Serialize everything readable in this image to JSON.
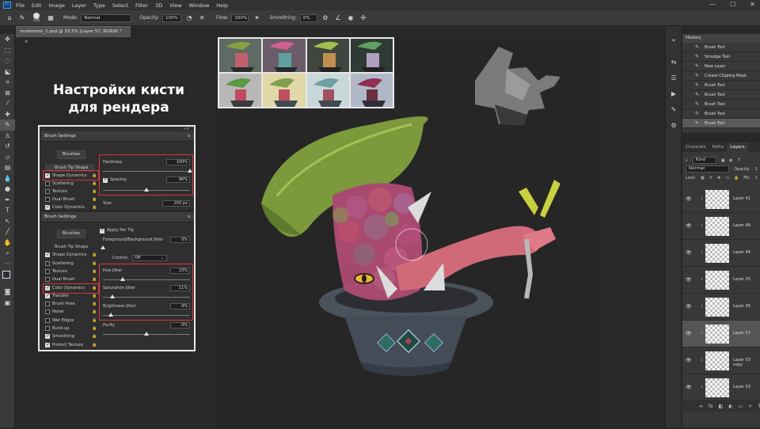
{
  "app": {
    "logo": "Ps"
  },
  "menu": [
    "File",
    "Edit",
    "Image",
    "Layer",
    "Type",
    "Select",
    "Filter",
    "3D",
    "View",
    "Window",
    "Help"
  ],
  "window_controls": [
    "—",
    "☐",
    "✕"
  ],
  "options_bar": {
    "brush_size": "200",
    "mode_label": "Mode:",
    "mode_value": "Normal",
    "opacity_label": "Opacity:",
    "opacity_value": "100%",
    "flow_label": "Flow:",
    "flow_value": "100%",
    "smoothing_label": "Smoothing:",
    "smoothing_value": "0%"
  },
  "document_tab": {
    "title": "mushroom_1.psd @ 33,3% (Layer 57, RGB/8) *",
    "close": "×"
  },
  "title_overlay": {
    "line1": "Настройки кисти",
    "line2": "для рендера"
  },
  "brush_panel": {
    "header": "Brush Settings",
    "top_section": {
      "brushes_button": "Brushes",
      "items": [
        {
          "label": "Brush Tip Shape",
          "checked": null
        },
        {
          "label": "Shape Dynamics",
          "checked": true
        },
        {
          "label": "Scattering",
          "checked": false
        },
        {
          "label": "Texture",
          "checked": false
        },
        {
          "label": "Dual Brush",
          "checked": false
        },
        {
          "label": "Color Dynamics",
          "checked": true
        }
      ],
      "hardness_label": "Hardness",
      "hardness_value": "100%",
      "hardness_level": 1.0,
      "spacing_label": "Spacing",
      "spacing_value": "96%",
      "spacing_level": 0.5,
      "size_label": "Size",
      "size_value": "200 px"
    },
    "bottom_section": {
      "header": "Brush Settings",
      "brushes_button": "Brushes",
      "apply_per_tip": "Apply Per Tip",
      "fg_bg_jitter_label": "Foreground/Background Jitter",
      "fg_bg_jitter_value": "0%",
      "control_label": "Control:",
      "control_value": "Off",
      "items": [
        {
          "label": "Brush Tip Shape",
          "checked": null
        },
        {
          "label": "Shape Dynamics",
          "checked": true
        },
        {
          "label": "Scattering",
          "checked": false
        },
        {
          "label": "Texture",
          "checked": false
        },
        {
          "label": "Dual Brush",
          "checked": false
        },
        {
          "label": "Color Dynamics",
          "checked": true
        },
        {
          "label": "Transfer",
          "checked": true
        },
        {
          "label": "Brush Pose",
          "checked": false
        },
        {
          "label": "Noise",
          "checked": false
        },
        {
          "label": "Wet Edges",
          "checked": false
        },
        {
          "label": "Build-up",
          "checked": false
        },
        {
          "label": "Smoothing",
          "checked": true
        },
        {
          "label": "Protect Texture",
          "checked": true
        }
      ],
      "hue_jitter_label": "Hue Jitter",
      "hue_jitter_value": "23%",
      "hue_jitter_level": 0.23,
      "saturation_jitter_label": "Saturation Jitter",
      "saturation_jitter_value": "11%",
      "saturation_jitter_level": 0.11,
      "brightness_jitter_label": "Brightness Jitter",
      "brightness_jitter_value": "9%",
      "brightness_jitter_level": 0.09,
      "purity_label": "Purity",
      "purity_value": "0%",
      "purity_level": 0.5
    }
  },
  "history": {
    "title": "History",
    "rows": [
      "Brush Tool",
      "Smudge Tool",
      "New Layer",
      "Create Clipping Mask",
      "Brush Tool",
      "Brush Tool",
      "Brush Tool",
      "Brush Tool",
      "Brush Tool"
    ]
  },
  "layers_panel": {
    "tabs": [
      "Channels",
      "Paths",
      "Layers"
    ],
    "kind_label": "Kind",
    "blend_mode": "Normal",
    "opacity_label": "Opacity:",
    "opacity_value": "1",
    "lock_label": "Lock:",
    "fill_label": "Fill:",
    "fill_value": "1",
    "layers": [
      {
        "name": "Layer 41",
        "selected": false
      },
      {
        "name": "Layer 46",
        "selected": false
      },
      {
        "name": "Layer 44",
        "selected": false
      },
      {
        "name": "Layer 25",
        "selected": false
      },
      {
        "name": "Layer 45",
        "selected": false
      },
      {
        "name": "Layer 57",
        "selected": true
      },
      {
        "name": "Layer 53 copy",
        "selected": false
      },
      {
        "name": "Layer 53",
        "selected": false
      }
    ],
    "footer_icons": [
      "∞",
      "fx",
      "◧",
      "◐",
      "▭",
      "+",
      "🗑"
    ]
  },
  "colors": {
    "accent_red": "#e03040",
    "panel_bg": "#2f2f2f",
    "canvas_bg": "#262626"
  }
}
